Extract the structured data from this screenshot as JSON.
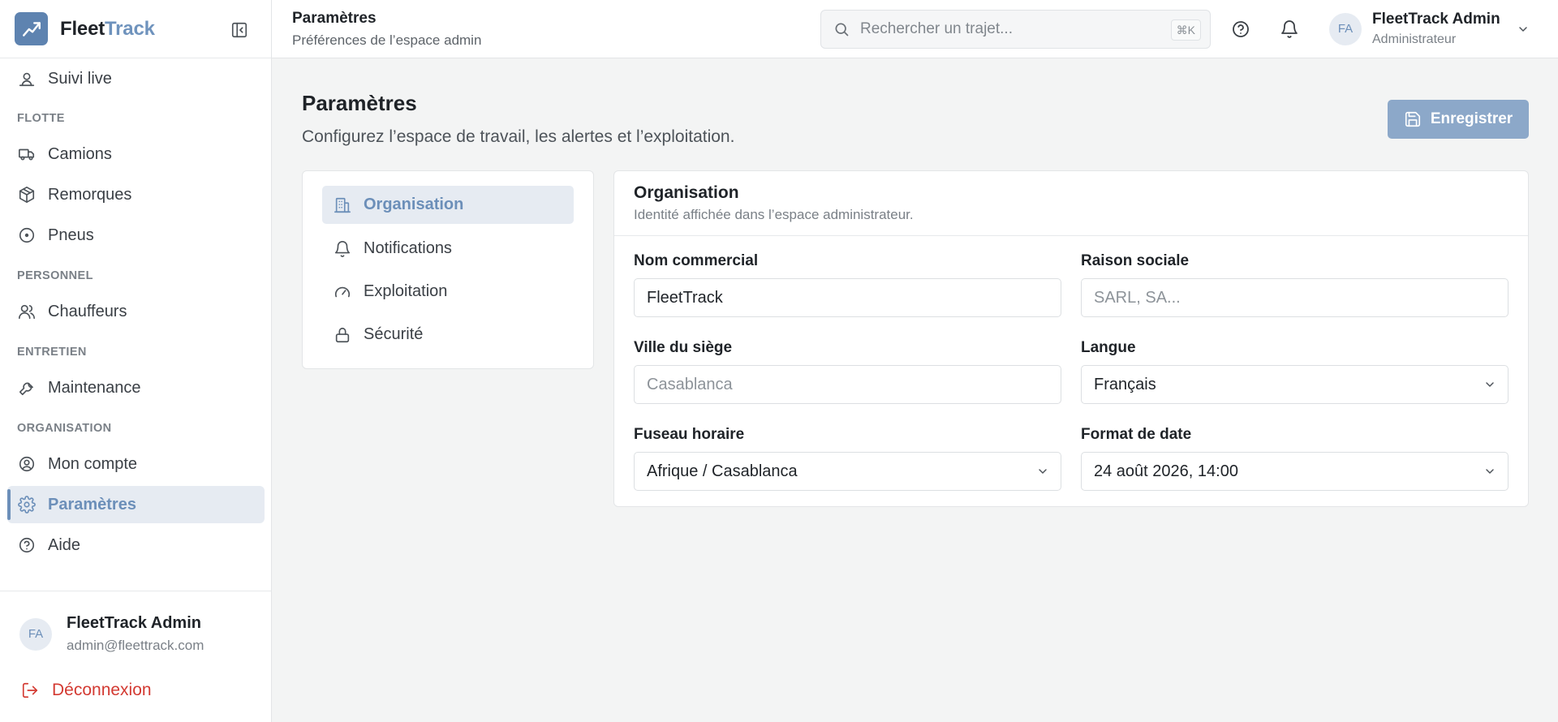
{
  "brand": {
    "name_primary": "Fleet",
    "name_accent": "Track"
  },
  "sidebar": {
    "top_item": "Suivi live",
    "sections": [
      {
        "title": "FLOTTE",
        "items": [
          "Camions",
          "Remorques",
          "Pneus"
        ]
      },
      {
        "title": "PERSONNEL",
        "items": [
          "Chauffeurs"
        ]
      },
      {
        "title": "ENTRETIEN",
        "items": [
          "Maintenance"
        ]
      },
      {
        "title": "ORGANISATION",
        "items": [
          "Mon compte",
          "Paramètres",
          "Aide"
        ]
      }
    ],
    "active_item": "Paramètres",
    "user": {
      "initials": "FA",
      "name": "FleetTrack Admin",
      "email": "admin@fleettrack.com"
    },
    "logout_label": "Déconnexion"
  },
  "header": {
    "title": "Paramètres",
    "subtitle": "Préférences de l’espace admin",
    "search_placeholder": "Rechercher un trajet...",
    "search_shortcut": "⌘K",
    "user": {
      "initials": "FA",
      "name": "FleetTrack Admin",
      "role": "Administrateur"
    }
  },
  "page": {
    "title": "Paramètres",
    "subtitle": "Configurez l’espace de travail, les alertes et l’exploitation.",
    "save_label": "Enregistrer"
  },
  "settings_menu": {
    "items": [
      "Organisation",
      "Notifications",
      "Exploitation",
      "Sécurité"
    ],
    "active": "Organisation"
  },
  "form": {
    "title": "Organisation",
    "subtitle": "Identité affichée dans l’espace administrateur.",
    "fields": {
      "nom_commercial": {
        "label": "Nom commercial",
        "value": "FleetTrack"
      },
      "raison_sociale": {
        "label": "Raison sociale",
        "placeholder": "SARL, SA..."
      },
      "ville_siege": {
        "label": "Ville du siège",
        "placeholder": "Casablanca"
      },
      "langue": {
        "label": "Langue",
        "value": "Français"
      },
      "fuseau_horaire": {
        "label": "Fuseau horaire",
        "value": "Afrique / Casablanca"
      },
      "format_date": {
        "label": "Format de date",
        "value": "24 août 2026, 14:00"
      }
    }
  },
  "colors": {
    "accent": "#6c8fb9",
    "logo": "#5e83b0",
    "active_bg": "#e6ebf2",
    "save_button": "#8ca8c9",
    "logout": "#d33a32"
  }
}
